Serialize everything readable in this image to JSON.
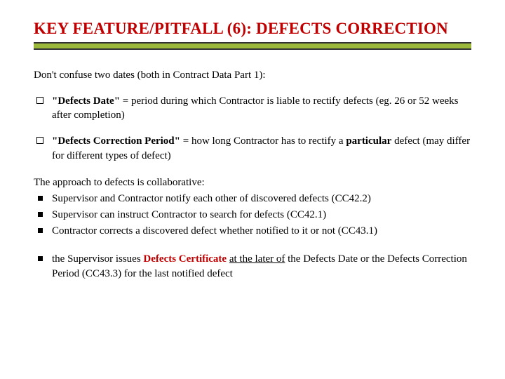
{
  "title": "KEY FEATURE/PITFALL (6): DEFECTS CORRECTION",
  "intro": "Don't confuse two dates (both in Contract Data Part 1):",
  "defs": [
    {
      "term": "\"Defects Date\"",
      "rest": " = period during which Contractor is liable to rectify defects (eg. 26 or 52 weeks after completion)"
    },
    {
      "term": "\"Defects Correction Period\"",
      "rest_a": " = how long Contractor has to rectify a ",
      "em": "particular",
      "rest_b": " defect (may differ for different types of defect)"
    }
  ],
  "collab_intro": "The approach to defects is collaborative:",
  "collab": [
    "Supervisor and Contractor notify each other of discovered defects (CC42.2)",
    "Supervisor can instruct Contractor to search for defects (CC42.1)",
    "Contractor corrects a discovered defect whether notified to it or not (CC43.1)"
  ],
  "cert": {
    "lead": "the Supervisor issues ",
    "red": "Defects Certificate",
    "mid": " ",
    "ul": "at the later of",
    "tail": " the Defects Date or the Defects Correction Period (CC43.3) for the last notified defect"
  }
}
